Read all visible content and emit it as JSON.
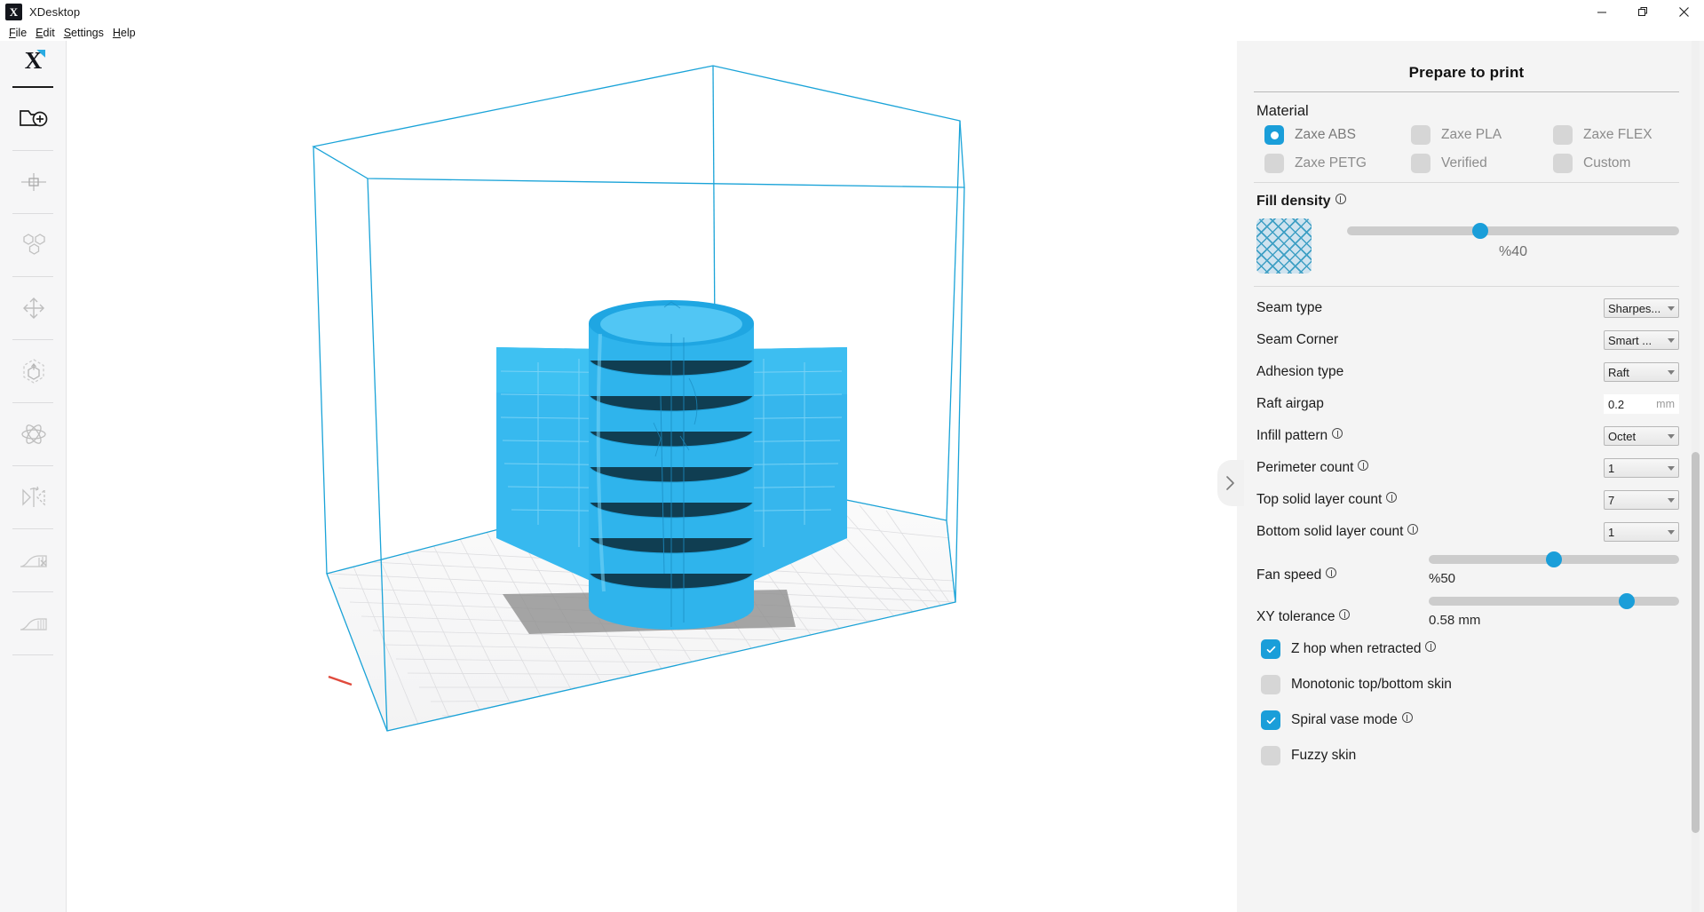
{
  "window": {
    "title": "XDesktop",
    "logo_letter": "X",
    "controls": [
      {
        "name": "minimize",
        "glyph": "minimize-icon"
      },
      {
        "name": "maximize",
        "glyph": "maximize-icon"
      },
      {
        "name": "close",
        "glyph": "close-icon"
      }
    ]
  },
  "menubar": {
    "items": [
      {
        "label": "File",
        "mnemonic": "F"
      },
      {
        "label": "Edit",
        "mnemonic": "E"
      },
      {
        "label": "Settings",
        "mnemonic": "S"
      },
      {
        "label": "Help",
        "mnemonic": "H"
      }
    ]
  },
  "toolbar": {
    "logo": "X",
    "tools": [
      {
        "name": "open-file-tool",
        "icon": "folder-add-icon"
      },
      {
        "name": "center-tool",
        "icon": "crosshair-icon"
      },
      {
        "name": "arrange-tool",
        "icon": "multi-cubes-icon"
      },
      {
        "name": "move-tool",
        "icon": "four-arrows-icon"
      },
      {
        "name": "scale-tool",
        "icon": "scale-cube-icon"
      },
      {
        "name": "rotate-tool",
        "icon": "rotate-orbit-icon"
      },
      {
        "name": "mirror-tool",
        "icon": "mirror-icon"
      },
      {
        "name": "support-remove-tool",
        "icon": "support-blocker-icon"
      },
      {
        "name": "support-add-tool",
        "icon": "support-icon"
      }
    ]
  },
  "viewport": {
    "build_plate_label": "",
    "model_color": "#29b6ec",
    "build_volume_color": "#1aa3d8",
    "grid_color": "#d0d0d2"
  },
  "panel": {
    "title": "Prepare to print",
    "collapse_icon": "chevron-right-icon",
    "material": {
      "label": "Material",
      "options": [
        {
          "label": "Zaxe ABS",
          "selected": true
        },
        {
          "label": "Zaxe PLA",
          "selected": false
        },
        {
          "label": "Zaxe FLEX",
          "selected": false
        },
        {
          "label": "Zaxe PETG",
          "selected": false
        },
        {
          "label": "Verified",
          "selected": false
        },
        {
          "label": "Custom",
          "selected": false
        }
      ]
    },
    "fill_density": {
      "label": "Fill density",
      "has_info": true,
      "value_text": "%40",
      "percent": 40,
      "swatch": "infill-pattern-swatch"
    },
    "settings": [
      {
        "name": "seam-type",
        "label": "Seam type",
        "info": false,
        "control": "select",
        "value": "Sharpes..."
      },
      {
        "name": "seam-corner",
        "label": "Seam Corner",
        "info": false,
        "control": "select",
        "value": "Smart ..."
      },
      {
        "name": "adhesion-type",
        "label": "Adhesion type",
        "info": false,
        "control": "select",
        "value": "Raft"
      },
      {
        "name": "raft-airgap",
        "label": "Raft airgap",
        "info": false,
        "control": "text",
        "value": "0.2",
        "unit": "mm"
      },
      {
        "name": "infill-pattern",
        "label": "Infill pattern",
        "info": true,
        "control": "select",
        "value": "Octet"
      },
      {
        "name": "perimeter-count",
        "label": "Perimeter count",
        "info": true,
        "control": "select",
        "value": "1"
      },
      {
        "name": "top-solid-layer",
        "label": "Top solid layer count",
        "info": true,
        "control": "select",
        "value": "7"
      },
      {
        "name": "bottom-solid-layer",
        "label": "Bottom solid layer count",
        "info": true,
        "control": "select",
        "value": "1"
      }
    ],
    "sliders": [
      {
        "name": "fan-speed",
        "label": "Fan speed",
        "info": true,
        "value_text": "%50",
        "percent": 50
      },
      {
        "name": "xy-tolerance",
        "label": "XY tolerance",
        "info": true,
        "value_text": "0.58 mm",
        "percent": 79
      }
    ],
    "checkboxes": [
      {
        "name": "z-hop-when-retracted",
        "label": "Z hop when retracted",
        "checked": true,
        "info": true
      },
      {
        "name": "monotonic-top-bottom",
        "label": "Monotonic top/bottom skin",
        "checked": false,
        "info": false
      },
      {
        "name": "spiral-vase-mode",
        "label": "Spiral vase mode",
        "checked": true,
        "info": true
      },
      {
        "name": "fuzzy-skin",
        "label": "Fuzzy skin",
        "checked": false,
        "info": false
      }
    ]
  },
  "colors": {
    "accent": "#1a9ed9",
    "panel_bg": "#f4f4f4",
    "rail_bg": "#f6f6f7",
    "text": "#1c1c1c",
    "muted": "#8c8c8c"
  }
}
